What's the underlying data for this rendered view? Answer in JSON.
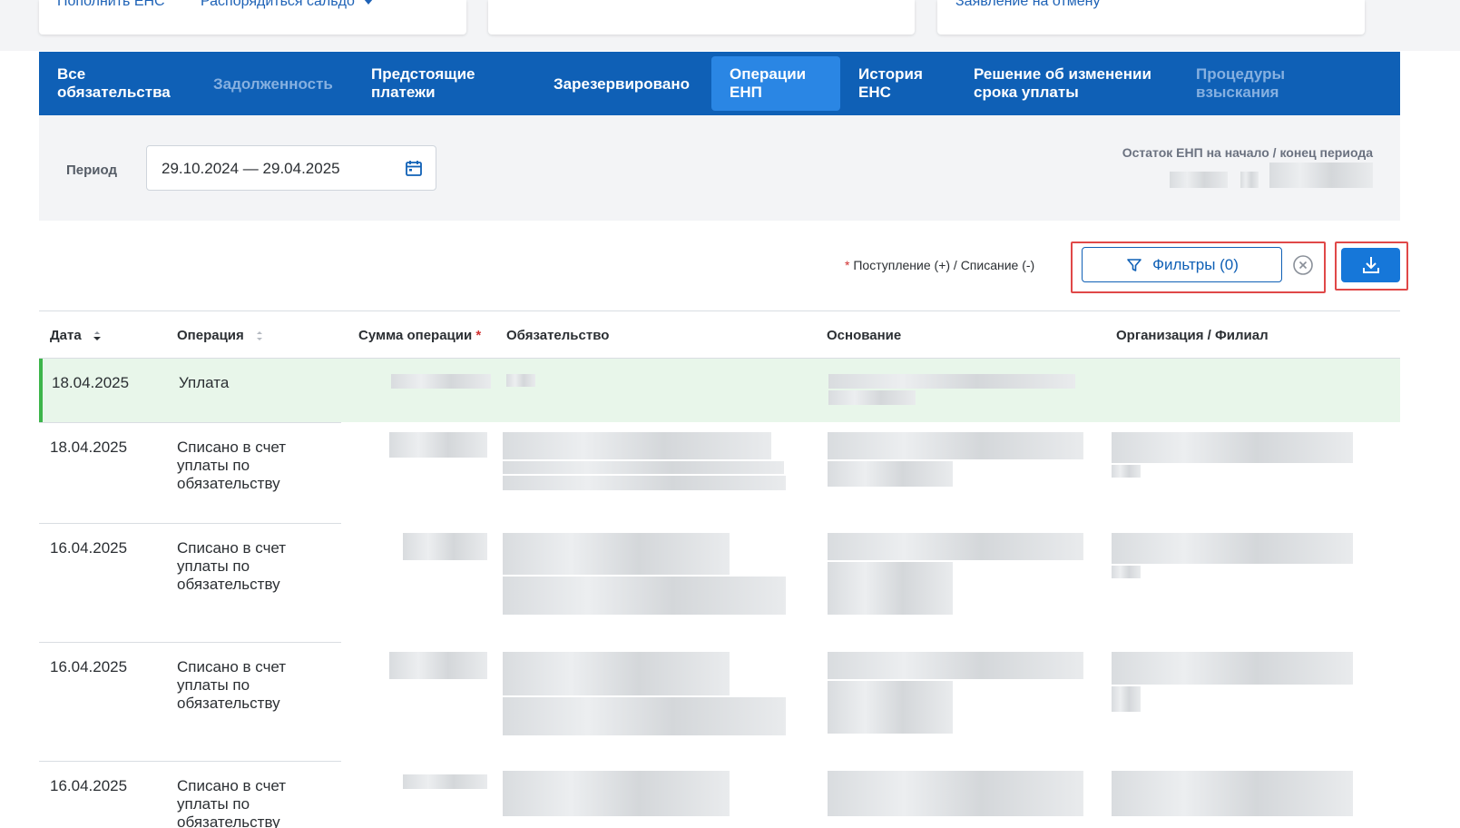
{
  "top_cards": {
    "card1": {
      "link1": "Пополнить ЕНС",
      "link2": "Распорядиться сальдо"
    },
    "card3": {
      "link1": "Заявление на отмену"
    }
  },
  "tabs": [
    {
      "label": "Все\nобязательства",
      "state": "normal"
    },
    {
      "label": "Задолженность",
      "state": "disabled"
    },
    {
      "label": "Предстоящие\nплатежи",
      "state": "normal"
    },
    {
      "label": "Зарезервировано",
      "state": "normal"
    },
    {
      "label": "Операции\nЕНП",
      "state": "active"
    },
    {
      "label": "История\nЕНС",
      "state": "normal"
    },
    {
      "label": "Решение об изменении\nсрока уплаты",
      "state": "normal"
    },
    {
      "label": "Процедуры\nвзыскания",
      "state": "disabled"
    }
  ],
  "period": {
    "label": "Период",
    "value": "29.10.2024 — 29.04.2025",
    "balance_label": "Остаток ЕНП на начало / конец периода"
  },
  "toolbar": {
    "legend_star": "*",
    "legend_text": "Поступление (+) / Списание (-)",
    "filter_label": "Фильтры (0)"
  },
  "table": {
    "headers": {
      "date": "Дата",
      "operation": "Операция",
      "amount": "Сумма операции",
      "amount_star": "*",
      "obligation": "Обязательство",
      "basis": "Основание",
      "organization": "Организация / Филиал"
    },
    "rows": [
      {
        "date": "18.04.2025",
        "operation": "Уплата",
        "highlighted": true
      },
      {
        "date": "18.04.2025",
        "operation": "Списано в счет уплаты по обязательству",
        "highlighted": false
      },
      {
        "date": "16.04.2025",
        "operation": "Списано в счет уплаты по обязательству",
        "highlighted": false
      },
      {
        "date": "16.04.2025",
        "operation": "Списано в счет уплаты по обязательству",
        "highlighted": false
      },
      {
        "date": "16.04.2025",
        "operation": "Списано в счет уплаты по обязательству",
        "highlighted": false
      }
    ]
  },
  "colors": {
    "primary": "#0f60b6",
    "tab_active": "#2a86e4",
    "highlight_row": "#e8f6ea",
    "highlight_border": "#3cb54a",
    "annotation_red": "#e04848"
  }
}
